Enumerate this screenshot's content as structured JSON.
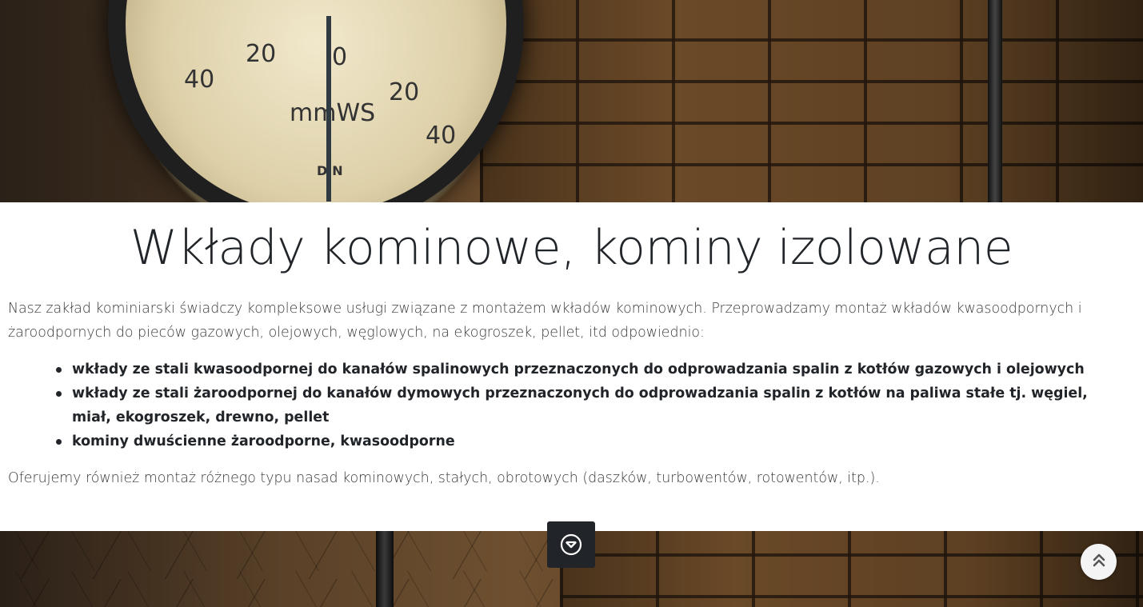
{
  "hero_top": {
    "image": "chimney-pressure-gauge",
    "gauge_readings": [
      "40",
      "20",
      "0",
      "20",
      "40"
    ],
    "gauge_unit": "mmWS",
    "gauge_brand": "DIN"
  },
  "main": {
    "title": "Wkłady kominowe, kominy izolowane",
    "intro": "Nasz zakład kominiarski świadczy kompleksowe usługi związane z montażem wkładów kominowych. Przeprowadzamy montaż wkładów kwasoodpornych i żaroodpornych do pieców gazowych, olejowych, węglowych, na ekogroszek, pellet, itd odpowiednio:",
    "features": [
      "wkłady ze stali kwasoodpornej do kanałów spalinowych przeznaczonych do odprowadzania spalin z kotłów gazowych i olejowych",
      "wkłady ze stali żaroodpornej do kanałów dymowych przeznaczonych do odprowadzania spalin z kotłów na paliwa stałe tj. węgiel, miał, ekogroszek, drewno, pellet",
      "kominy dwuścienne żaroodporne, kwasoodporne"
    ],
    "offer": "Oferujemy również montaż różnego typu nasad kominowych, stałych, obrotowych (daszków, turbowentów, rotowentów, itp.)."
  },
  "hero_bottom": {
    "image": "brick-wall-with-pipe"
  },
  "controls": {
    "scroll_down_icon": "chevron-down-circle-icon",
    "back_to_top_icon": "double-chevron-up-icon"
  },
  "colors": {
    "text": "#212529",
    "scroll_button_bg": "#212529",
    "back_to_top_bg": "#f4f4f4"
  }
}
